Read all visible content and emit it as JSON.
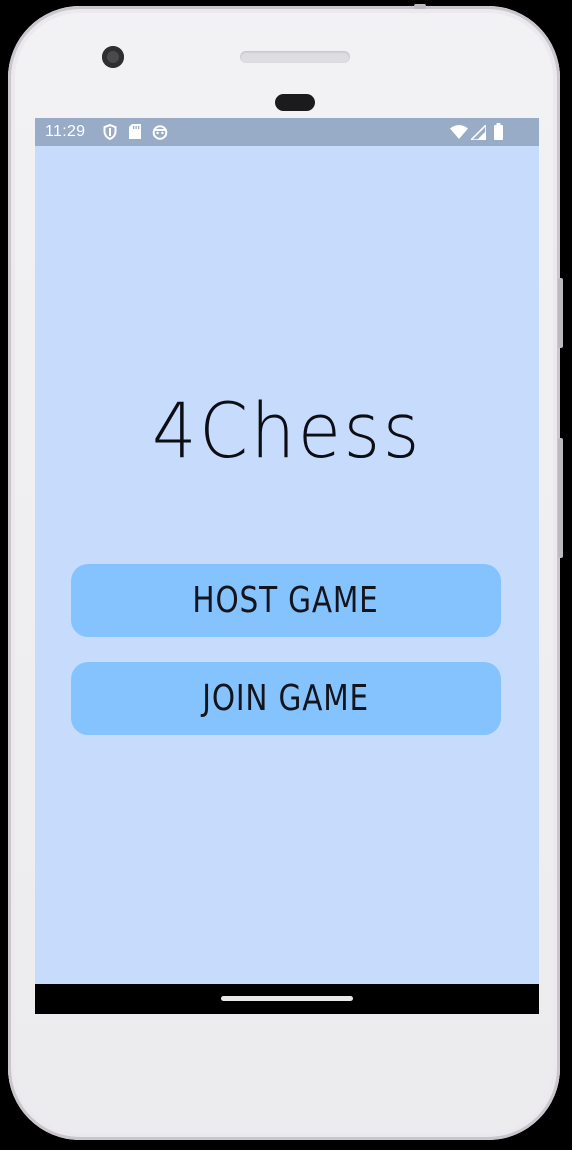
{
  "status_bar": {
    "time": "11:29",
    "left_icons": [
      "shield-icon",
      "sd-card-icon",
      "android-face-icon"
    ],
    "right_icons": [
      "wifi-icon",
      "cell-signal-icon",
      "battery-icon"
    ]
  },
  "app": {
    "title": "4Chess",
    "host_label": "HOST GAME",
    "join_label": "JOIN GAME"
  },
  "colors": {
    "screen_background": "#c7dcfd",
    "status_bar_background": "#98abc7",
    "button_background": "#85c3fe",
    "text": "#0d0d14",
    "nav_bar": "#000000"
  }
}
